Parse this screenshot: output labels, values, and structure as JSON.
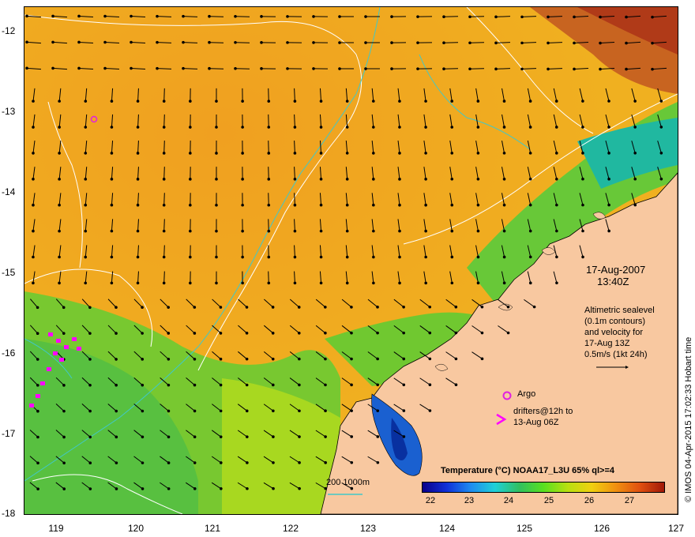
{
  "map": {
    "lat_ticks": [
      "-12",
      "-13",
      "-14",
      "-15",
      "-16",
      "-17",
      "-18"
    ],
    "lon_ticks": [
      "119",
      "120",
      "121",
      "122",
      "123",
      "124",
      "125",
      "126",
      "127"
    ],
    "lon_range": [
      118.6,
      127.0
    ],
    "lat_range": [
      -12.0,
      -18.0
    ],
    "land_color": "#f8c8a0",
    "contour_color": "#ffffff",
    "isobath_color": "#40c8c8",
    "argo_color": "#e020e0",
    "drifter_color": "#ff00ff"
  },
  "annotations": {
    "date": "17-Aug-2007",
    "time": "13:40Z",
    "info_line1": "Altimetric sealevel",
    "info_line2": "(0.1m contours)",
    "info_line3": "and velocity for",
    "info_line4": "17-Aug 13Z",
    "info_line5": "0.5m/s (1kt 24h)",
    "argo": "Argo",
    "drifters_line1": "drifters@12h to",
    "drifters_line2": "13-Aug 06Z",
    "isobath_scale": "200  1000m"
  },
  "legend": {
    "title": "Temperature (°C) NOAA17_L3U 65% ql>=4",
    "ticks": [
      "22",
      "23",
      "24",
      "25",
      "26",
      "27"
    ],
    "range": [
      21.6,
      27.8
    ]
  },
  "credit": "© IMOS 04-Apr-2015 17:02:33 Hobart time"
}
